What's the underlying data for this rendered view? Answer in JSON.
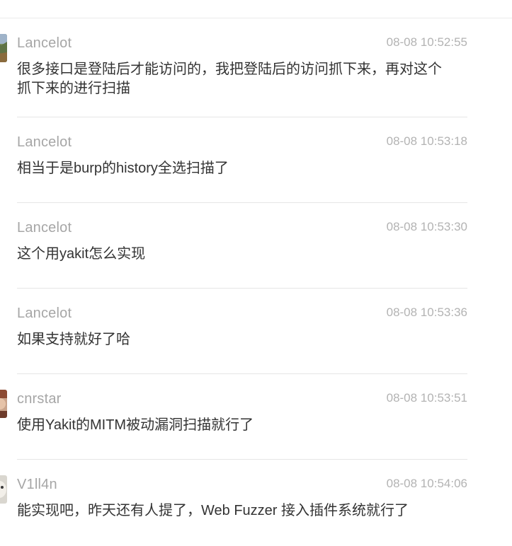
{
  "messages": [
    {
      "author": "Lancelot",
      "time": "08-08 10:52:55",
      "text": "很多接口是登陆后才能访问的，我把登陆后的访问抓下来，再对这个抓下来的进行扫描",
      "avatar": "landscape"
    },
    {
      "author": "Lancelot",
      "time": "08-08 10:53:18",
      "text": "相当于是burp的history全选扫描了"
    },
    {
      "author": "Lancelot",
      "time": "08-08 10:53:30",
      "text": "这个用yakit怎么实现"
    },
    {
      "author": "Lancelot",
      "time": "08-08 10:53:36",
      "text": "如果支持就好了哈"
    },
    {
      "author": "cnrstar",
      "time": "08-08 10:53:51",
      "text": "使用Yakit的MITM被动漏洞扫描就行了",
      "avatar": "portrait"
    },
    {
      "author": "V1ll4n",
      "time": "08-08 10:54:06",
      "text": "能实现吧，昨天还有人提了，Web Fuzzer 接入插件系统就行了",
      "avatar": "animal"
    }
  ]
}
